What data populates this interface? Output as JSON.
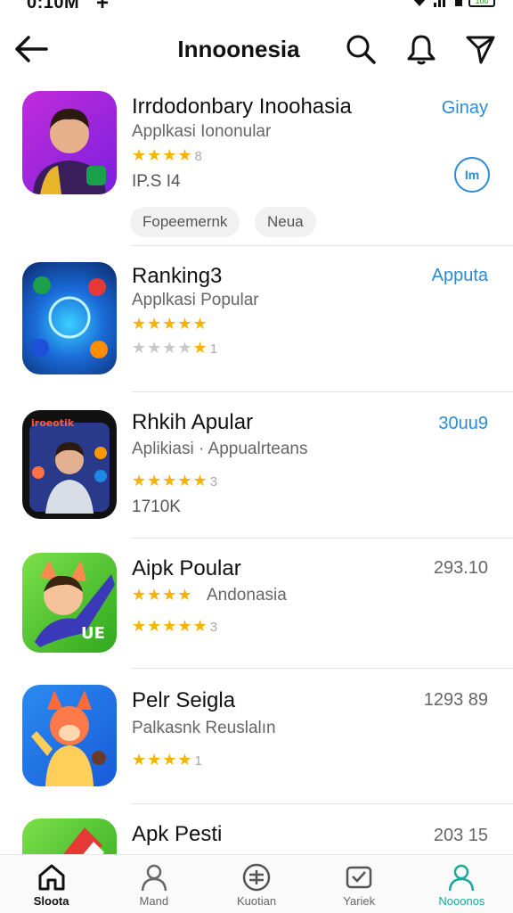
{
  "status": {
    "time": "0:10M",
    "plus": "+",
    "battery": "100"
  },
  "header": {
    "title": "Innoonesia"
  },
  "apps": [
    {
      "name": "Irrdodonbary Inoohasia",
      "subtitle": "Applkasi Iononular",
      "stars": "★★★★",
      "stars_num": "8",
      "meta": "IP.S I4",
      "action": "Ginay",
      "circle_label": "Im",
      "chips": [
        "Fopeemernk",
        "Neua"
      ]
    },
    {
      "name": "Ranking3",
      "subtitle": "Applkasi Popular",
      "stars": "★★★★★",
      "stars_row2_on": "★",
      "stars_row2_off": "★★★★",
      "stars_row2_num": "1",
      "action": "Apputa"
    },
    {
      "name": "Rhkih Apular",
      "subtitle": "Aplikiasi · Appualrteans",
      "stars": "★★★★★",
      "stars_num": "3",
      "meta": "1710K",
      "action": "30uu9"
    },
    {
      "name": "Aipk Poular",
      "subtitle": "Andonasia",
      "stars_inline": "★★★★",
      "stars": "★★★★★",
      "stars_num": "3",
      "side": "293.10"
    },
    {
      "name": "Pelr Seigla",
      "subtitle": "Palkasnk Reuslalın",
      "stars": "★★★★",
      "stars_num": "1",
      "side": "1293 89"
    },
    {
      "name": "Apk Pesti",
      "side": "203 15"
    }
  ],
  "nav": [
    {
      "label": "Sloota"
    },
    {
      "label": "Mand"
    },
    {
      "label": "Kuotian"
    },
    {
      "label": "Yariek"
    },
    {
      "label": "Nooonos"
    }
  ],
  "colors": {
    "accent": "#2a8cd8",
    "star": "#f4b400",
    "teal": "#1aa89a"
  }
}
